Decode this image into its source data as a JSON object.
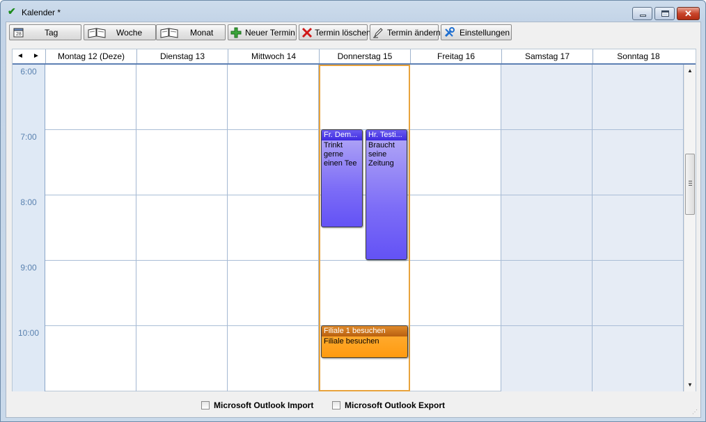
{
  "window": {
    "title": "Kalender *",
    "icons": {
      "app": "check-icon",
      "minimize": "minimize-icon",
      "maximize": "maximize-icon",
      "close": "close-icon"
    }
  },
  "toolbar": {
    "buttons": [
      {
        "label": "Tag",
        "icon": "calendar-day-icon"
      },
      {
        "label": "Woche",
        "icon": "book-open-icon"
      },
      {
        "label": "Monat",
        "icon": "book-open-icon"
      },
      {
        "label": "Neuer Termin",
        "icon": "plus-icon"
      },
      {
        "label": "Termin löschen",
        "icon": "delete-x-icon"
      },
      {
        "label": "Termin ändern",
        "icon": "edit-pencil-icon"
      },
      {
        "label": "Einstellungen",
        "icon": "settings-tools-icon"
      }
    ]
  },
  "calendar": {
    "nav": {
      "prev": "◄",
      "next": "►"
    },
    "days": [
      {
        "label": "Montag 12 (Deze)",
        "weekend": false
      },
      {
        "label": "Dienstag 13",
        "weekend": false
      },
      {
        "label": "Mittwoch 14",
        "weekend": false
      },
      {
        "label": "Donnerstag 15",
        "weekend": false,
        "selected": true
      },
      {
        "label": "Freitag 16",
        "weekend": false
      },
      {
        "label": "Samstag 17",
        "weekend": true
      },
      {
        "label": "Sonntag 18",
        "weekend": true
      }
    ],
    "times": [
      "6:00",
      "7:00",
      "8:00",
      "9:00",
      "10:00"
    ],
    "appointments": [
      {
        "title": "Fr. Dem...",
        "body": "Trinkt gerne einen Tee",
        "day": "Donnerstag 15",
        "start": "7:00",
        "end": "8:30",
        "color": "#7d6df7"
      },
      {
        "title": "Hr. Testi...",
        "body": "Braucht seine Zeitung",
        "day": "Donnerstag 15",
        "start": "7:00",
        "end": "9:00",
        "color": "#7d6df7"
      },
      {
        "title": "Filiale 1 besuchen",
        "body": "Filiale besuchen",
        "day": "Donnerstag 15",
        "start": "10:00",
        "end": "10:30",
        "color": "#ff9a10"
      }
    ],
    "colors": {
      "today_border": "#e8a33c",
      "weekend_bg": "#e6ecf5",
      "time_col_bg": "#dfe9f5"
    }
  },
  "footer": {
    "import_label": "Microsoft Outlook Import",
    "import_checked": false,
    "export_label": "Microsoft Outlook Export",
    "export_checked": false
  }
}
